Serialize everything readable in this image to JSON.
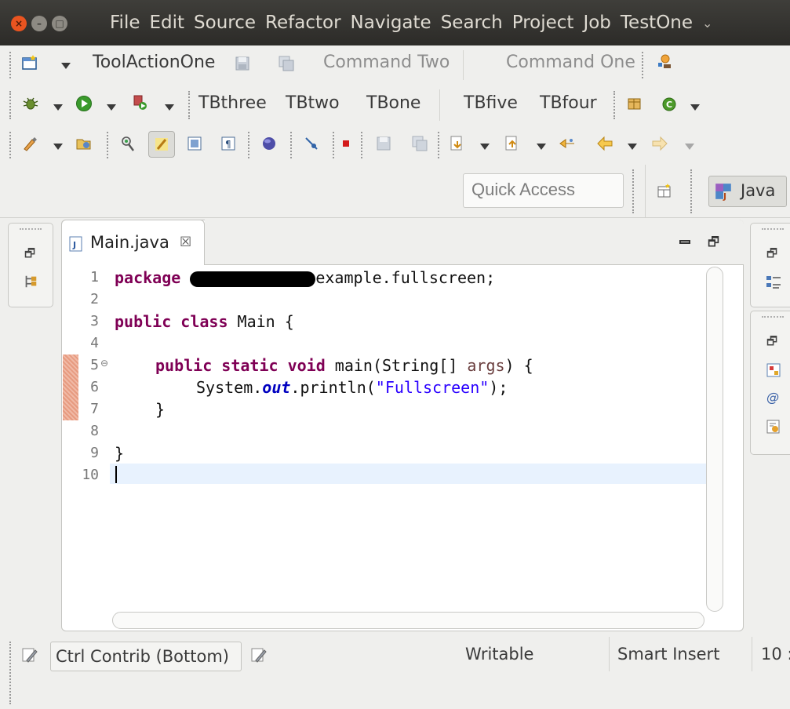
{
  "window": {
    "controls": [
      "close-icon",
      "minimize-icon",
      "maximize-icon"
    ]
  },
  "menu": [
    "File",
    "Edit",
    "Source",
    "Refactor",
    "Navigate",
    "Search",
    "Project",
    "Job",
    "TestOne"
  ],
  "toolbar1": {
    "tool_action_one": "ToolActionOne",
    "command_two": "Command Two",
    "command_one": "Command One"
  },
  "toolbar2": {
    "tbthree": "TBthree",
    "tbtwo": "TBtwo",
    "tbone": "TBone",
    "tbfive": "TBfive",
    "tbfour": "TBfour"
  },
  "quick_access": {
    "placeholder": "Quick Access"
  },
  "perspective": {
    "label": "Java"
  },
  "editor": {
    "tab_label": "Main.java",
    "line_numbers": [
      "1",
      "2",
      "3",
      "4",
      "5",
      "6",
      "7",
      "8",
      "9",
      "10"
    ],
    "code": {
      "l1_kw": "package",
      "l1_rest": "example.fullscreen;",
      "l3_kw": "public class",
      "l3_rest": " Main {",
      "l5_kw": "public static void",
      "l5_rest_a": " main(String[] ",
      "l5_param": "args",
      "l5_rest_b": ") {",
      "l6_a": "System.",
      "l6_field": "out",
      "l6_b": ".println(",
      "l6_str": "\"Fullscreen\"",
      "l6_c": ");",
      "l7": "}",
      "l9": "}"
    }
  },
  "status": {
    "ctrl_contrib": "Ctrl Contrib (Bottom)",
    "writable": "Writable",
    "insert_mode": "Smart Insert",
    "position": "10 :"
  },
  "colors": {
    "menubar": "#3a3935",
    "close": "#e95420",
    "keyword": "#7f0055",
    "string": "#2a00ff",
    "current_line": "#e8f2fe",
    "change_marker": "#e8a58c"
  }
}
